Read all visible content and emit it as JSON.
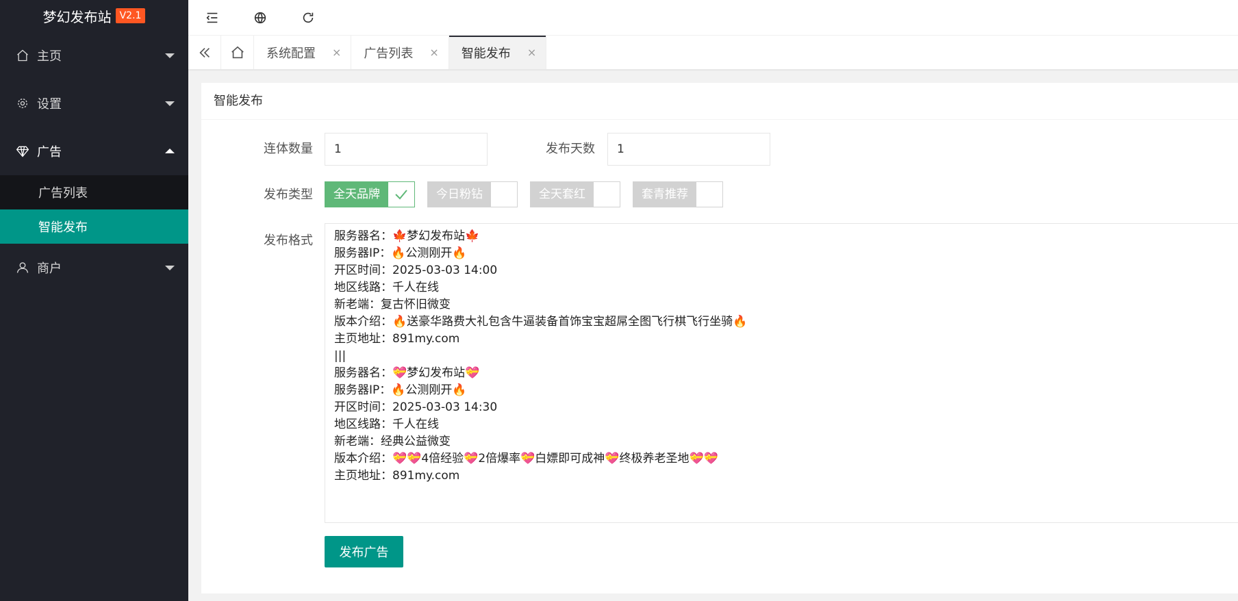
{
  "brand": {
    "name": "梦幻发布站",
    "version": "V2.1"
  },
  "sidebar": {
    "items": [
      {
        "label": "主页",
        "icon": "home-icon"
      },
      {
        "label": "设置",
        "icon": "gear-icon"
      },
      {
        "label": "广告",
        "icon": "diamond-icon"
      },
      {
        "label": "商户",
        "icon": "user-icon"
      }
    ],
    "ad_sub": [
      {
        "label": "广告列表"
      },
      {
        "label": "智能发布"
      }
    ]
  },
  "header": {
    "icons": [
      "menu-collapse-icon",
      "globe-icon",
      "refresh-icon"
    ]
  },
  "tabs": [
    {
      "label": "系统配置",
      "close": "×"
    },
    {
      "label": "广告列表",
      "close": "×"
    },
    {
      "label": "智能发布",
      "close": "×"
    }
  ],
  "card": {
    "title": "智能发布",
    "fields": {
      "count_label": "连体数量",
      "count_value": "1",
      "days_label": "发布天数",
      "days_value": "1",
      "type_label": "发布类型",
      "format_label": "发布格式"
    },
    "types": [
      {
        "label": "全天品牌",
        "checked": true
      },
      {
        "label": "今日粉钻",
        "checked": false
      },
      {
        "label": "全天套红",
        "checked": false
      },
      {
        "label": "套青推荐",
        "checked": false
      }
    ],
    "format_text": "服务器名：🍁梦幻发布站🍁\n服务器IP：🔥公测刚开🔥\n开区时间：2025-03-03 14:00\n地区线路：千人在线\n新老端：复古怀旧微变\n版本介绍：🔥送豪华路费大礼包含牛逼装备首饰宝宝超屌全图飞行棋飞行坐骑🔥\n主页地址：891my.com\n|||\n服务器名：💝梦幻发布站💝\n服务器IP：🔥公测刚开🔥\n开区时间：2025-03-03 14:30\n地区线路：千人在线\n新老端：经典公益微变\n版本介绍：💝💝4倍经验💝2倍爆率💝白嫖即可成神💝终极养老圣地💝💝\n主页地址：891my.com",
    "submit_label": "发布广告"
  },
  "colors": {
    "sidebar_bg": "#20222a",
    "accent": "#009688",
    "switch_on": "#5fb878",
    "version_badge": "#ff5722"
  }
}
